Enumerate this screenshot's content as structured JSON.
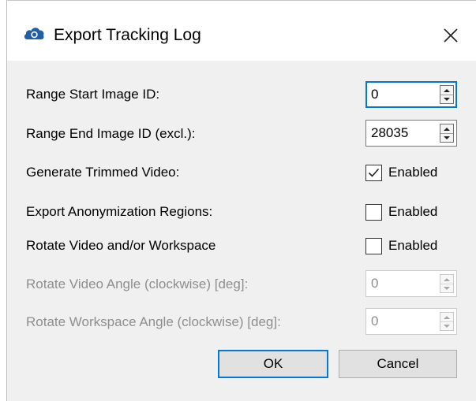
{
  "dialog": {
    "title": "Export Tracking Log",
    "icon": "cloud-icon",
    "close_icon": "close-icon"
  },
  "fields": {
    "range_start": {
      "label": "Range Start Image ID:",
      "value": "0"
    },
    "range_end": {
      "label": "Range End Image ID (excl.):",
      "value": "28035"
    },
    "generate_trimmed_video": {
      "label": "Generate Trimmed Video:",
      "checkbox_label": "Enabled",
      "checked": true
    },
    "export_anonymization": {
      "label": "Export Anonymization Regions:",
      "checkbox_label": "Enabled",
      "checked": false
    },
    "rotate_video_workspace": {
      "label": "Rotate Video and/or Workspace",
      "checkbox_label": "Enabled",
      "checked": false
    },
    "rotate_video_angle": {
      "label": "Rotate Video Angle (clockwise) [deg]:",
      "value": "0",
      "disabled": true
    },
    "rotate_workspace_angle": {
      "label": "Rotate Workspace Angle (clockwise) [deg]:",
      "value": "0",
      "disabled": true
    }
  },
  "buttons": {
    "ok": "OK",
    "cancel": "Cancel"
  },
  "colors": {
    "accent": "#0078d7",
    "icon_blue": "#1e5fa8",
    "disabled_text": "#8e8e8e",
    "client_bg": "#f0f0f0"
  }
}
